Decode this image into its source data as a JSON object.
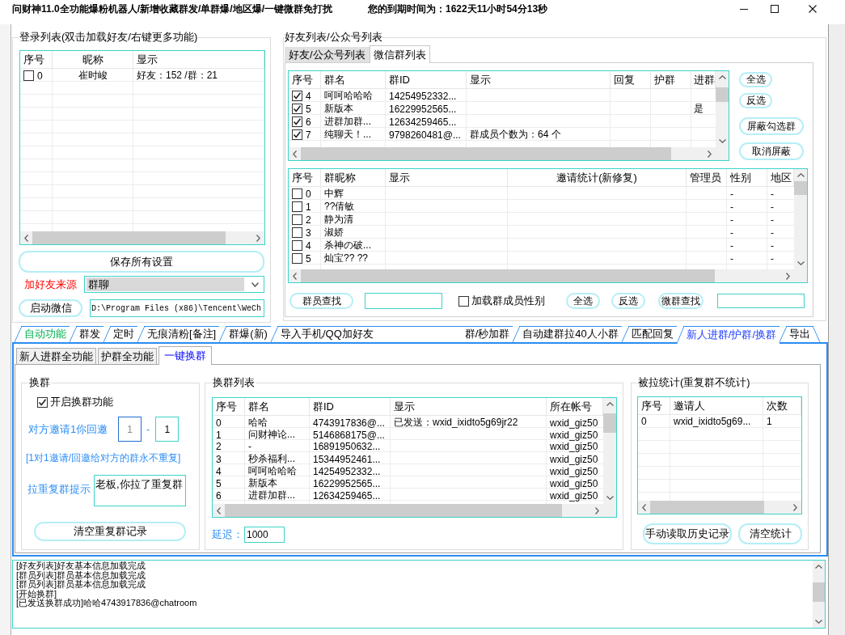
{
  "window": {
    "title": "问财神11.0全功能爆粉机器人/新增收藏群发/单群爆/地区爆/一键微群免打扰",
    "expiry": "您的到期时间为：1622天11小时54分13秒"
  },
  "login_list": {
    "title": "登录列表(双击加载好友/右键更多功能)",
    "columns": [
      "序号",
      "昵称",
      "显示"
    ],
    "rows": [
      {
        "checked": false,
        "index": "0",
        "nickname": "崔时峻",
        "display": "好友：152 /群：21"
      }
    ]
  },
  "save_button": "保存所有设置",
  "friend_source": {
    "label": "加好友来源",
    "value": "群聊"
  },
  "start_button": "启动微信",
  "wechat_path": "D:\\Program Files (x86)\\Tencent\\WeCh",
  "friend_list": {
    "title": "好友列表/公众号列表",
    "tabs": [
      {
        "label": "好友/公众号列表",
        "selected": false
      },
      {
        "label": "微信群列表",
        "selected": true
      }
    ],
    "group_table": {
      "columns": [
        "序号",
        "群名",
        "群ID",
        "显示",
        "回复",
        "护群",
        "进群"
      ],
      "rows": [
        {
          "checked": true,
          "index": "4",
          "name": "呵呵哈哈哈",
          "id": "14254952332..."
        },
        {
          "checked": true,
          "index": "5",
          "name": "新版本",
          "id": "16229952565...",
          "join": "是"
        },
        {
          "checked": true,
          "index": "6",
          "name": "进群加群...",
          "id": "12634259465..."
        },
        {
          "checked": true,
          "index": "7",
          "name": "纯聊天！...",
          "id": "9798260481@...",
          "display": "群成员个数为：64 个"
        }
      ]
    },
    "group_buttons": [
      "全选",
      "反选",
      "屏蔽勾选群",
      "取消屏蔽"
    ],
    "member_table": {
      "columns": [
        "序号",
        "群昵称",
        "显示",
        "邀请统计(新修复)",
        "管理员",
        "性别",
        "地区"
      ],
      "rows": [
        {
          "checked": false,
          "index": "0",
          "nickname": "中辉",
          "gender": "-",
          "region": "-"
        },
        {
          "checked": false,
          "index": "1",
          "nickname": "??倩敏",
          "gender": "-",
          "region": "-"
        },
        {
          "checked": false,
          "index": "2",
          "nickname": "静为清",
          "gender": "-",
          "region": "-"
        },
        {
          "checked": false,
          "index": "3",
          "nickname": "淑娇",
          "gender": "-",
          "region": "-"
        },
        {
          "checked": false,
          "index": "4",
          "nickname": "杀神の破...",
          "gender": "-",
          "region": "-"
        },
        {
          "checked": false,
          "index": "5",
          "nickname": "灿宝?? ??",
          "gender": "-",
          "region": "-"
        }
      ]
    },
    "member_search_button": "群员查找",
    "load_gender": {
      "label": "加载群成员性别",
      "checked": false
    },
    "member_buttons": [
      "全选",
      "反选",
      "微群查找"
    ]
  },
  "main_tabs": [
    {
      "label": "自动功能",
      "selected": false,
      "color": "#00b050"
    },
    {
      "label": "群发",
      "selected": false
    },
    {
      "label": "定时",
      "selected": false
    },
    {
      "label": "无痕清粉[备注]",
      "selected": false
    },
    {
      "label": "群爆(新)",
      "selected": false
    },
    {
      "label": "导入手机/QQ加好友",
      "label_end": "群/秒加群",
      "selected": false
    },
    {
      "label": "自动建群拉40人小群",
      "selected": false
    },
    {
      "label": "匹配回复",
      "selected": false
    },
    {
      "label": "新人进群/护群/换群",
      "selected": true,
      "color": "#1e3cff"
    },
    {
      "label": "导出",
      "selected": false
    }
  ],
  "sub_tabs": [
    {
      "label": "新人进群全功能",
      "selected": false
    },
    {
      "label": "护群全功能",
      "selected": false
    },
    {
      "label": "一键换群",
      "selected": true
    }
  ],
  "swap_settings": {
    "title": "换群",
    "enable": {
      "label": "开启换群功能",
      "checked": true
    },
    "invite_label": "对方邀请1你回邀",
    "invite_from": "1",
    "separator": "-",
    "invite_to": "1",
    "note": "[1对1邀请/回邀给对方的群永不重复]",
    "repeat_label": "拉重复群提示",
    "repeat_message": "老板,你拉了重复群",
    "clear_button": "清空重复群记录"
  },
  "swap_list": {
    "title": "换群列表",
    "columns": [
      "序号",
      "群名",
      "群ID",
      "显示",
      "所在帐号"
    ],
    "rows": [
      {
        "index": "0",
        "name": "哈哈",
        "id": "4743917836@...",
        "display": "已发送：wxid_ixidto5g69jr22",
        "account": "wxid_giz50"
      },
      {
        "index": "1",
        "name": "问财神论...",
        "id": "5146868175@...",
        "account": "wxid_giz50"
      },
      {
        "index": "2",
        "name": "-",
        "id": "16891950632...",
        "account": "wxid_giz50"
      },
      {
        "index": "3",
        "name": "秒杀福利...",
        "id": "15344952461...",
        "account": "wxid_giz50"
      },
      {
        "index": "4",
        "name": "呵呵哈哈哈",
        "id": "14254952332...",
        "account": "wxid_giz50"
      },
      {
        "index": "5",
        "name": "新版本",
        "id": "16229952565...",
        "account": "wxid_giz50"
      },
      {
        "index": "6",
        "name": "进群加群...",
        "id": "12634259465...",
        "account": "wxid_giz50"
      }
    ],
    "delay_label": "延迟：",
    "delay_value": "1000"
  },
  "pulled_stats": {
    "title": "被拉统计(重复群不统计)",
    "columns": [
      "序号",
      "邀请人",
      "次数"
    ],
    "rows": [
      {
        "index": "0",
        "inviter": "wxid_ixidto5g69...",
        "count": "1"
      }
    ],
    "buttons": [
      "手动读取历史记录",
      "清空统计"
    ]
  },
  "log": [
    "[好友列表]好友基本信息加载完成",
    "[群员列表]群员基本信息加载完成",
    "[群员列表]群员基本信息加载完成",
    "[开始换群]",
    "[已发送换群成功]哈哈4743917836@chatroom"
  ]
}
